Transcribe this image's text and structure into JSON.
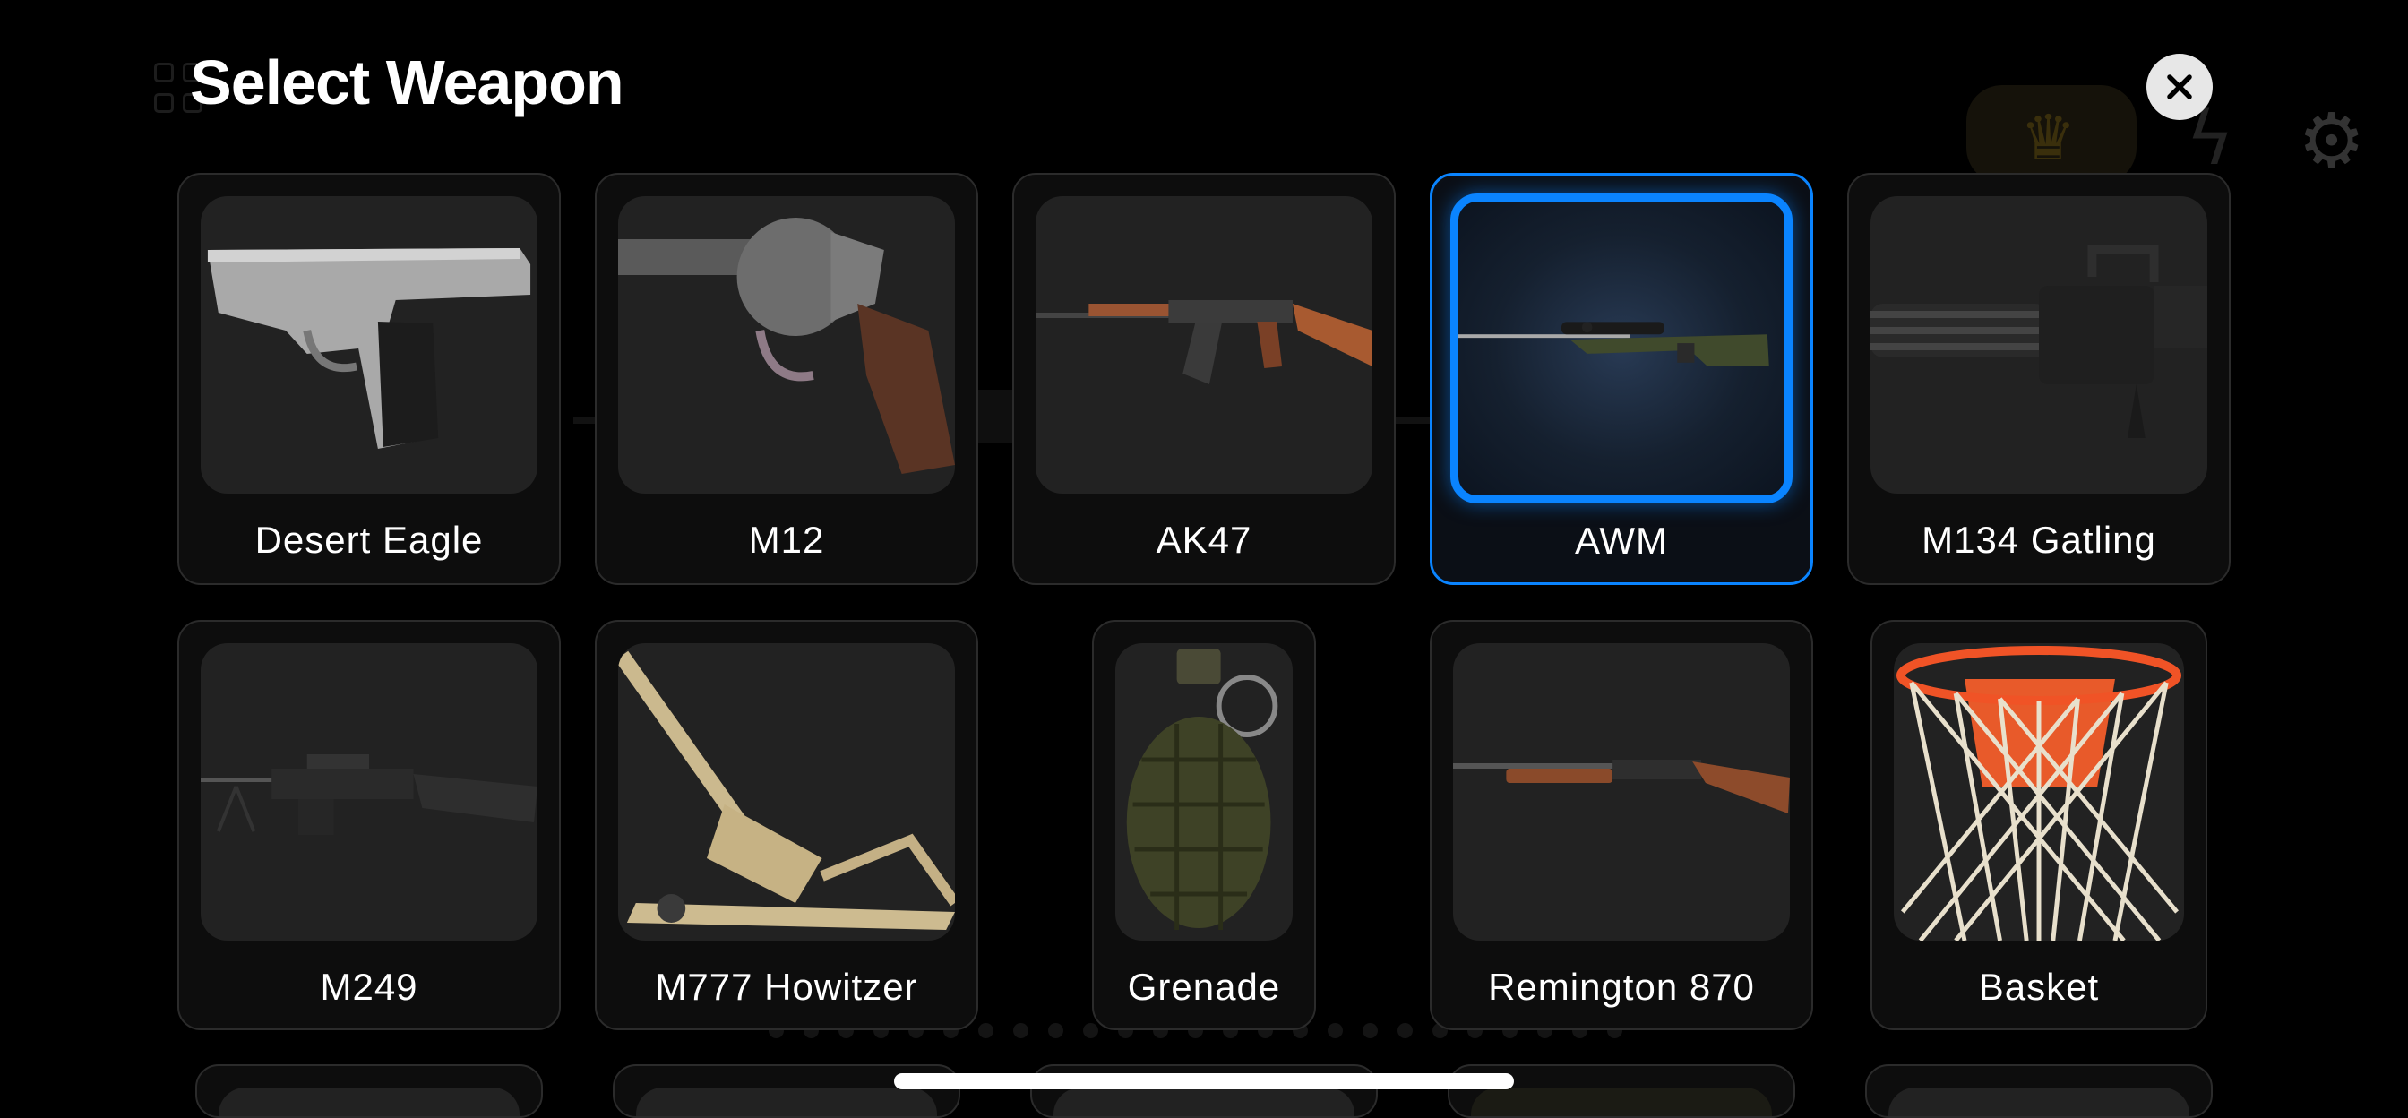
{
  "header": {
    "title": "Select Weapon"
  },
  "weapons": [
    {
      "label": "Desert Eagle"
    },
    {
      "label": "M12"
    },
    {
      "label": "AK47"
    },
    {
      "label": "AWM",
      "selected": true
    },
    {
      "label": "M134 Gatling"
    },
    {
      "label": "M249"
    },
    {
      "label": "M777 Howitzer"
    },
    {
      "label": "Grenade"
    },
    {
      "label": "Remington 870"
    },
    {
      "label": "Basket"
    }
  ],
  "colors": {
    "accent": "#0a84ff",
    "card_bg": "#0d0d0d",
    "thumb_bg": "#222222"
  },
  "icons": {
    "close": "close-icon",
    "settings": "gear-icon",
    "premium": "crown-icon",
    "flash": "flash-off-icon"
  }
}
